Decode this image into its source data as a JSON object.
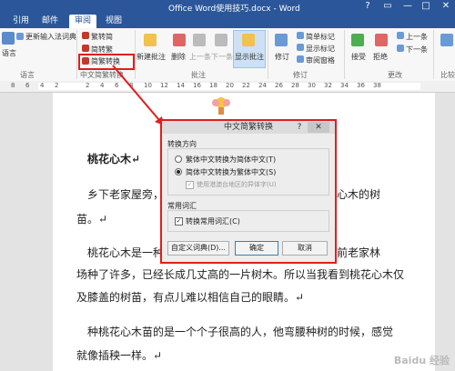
{
  "app": {
    "title": "Office Word使用技巧.docx - Word",
    "tabs": [
      "引用",
      "邮件",
      "审阅",
      "视图"
    ],
    "active_tab": "审阅",
    "window_buttons": [
      "?",
      "▭",
      "—",
      "□",
      "✕"
    ]
  },
  "ribbon": {
    "language": {
      "update_dict": "更新输入法词典",
      "label": "语言",
      "lang_btn": "语言"
    },
    "chinese": {
      "trad_to_simp": "繁转简",
      "simp_to_trad": "简转繁",
      "convert": "简繁转换",
      "label": "中文简繁转换"
    },
    "comments": {
      "new": "新建批注",
      "delete": "删除",
      "previous": "上一条",
      "next": "下一条",
      "show": "显示批注",
      "label": "批注"
    },
    "tracking": {
      "track": "修订",
      "simple_markup": "简单标记",
      "show_markup": "显示标记",
      "review_pane": "审阅窗格",
      "label": "修订"
    },
    "changes": {
      "accept": "接受",
      "reject": "拒绝",
      "prev": "上一条",
      "next": "下一条",
      "label": "更改"
    },
    "compare": {
      "label": "比较"
    }
  },
  "ruler": {
    "numbers": [
      "8",
      "6",
      "4",
      "2",
      "2",
      "4",
      "6",
      "8",
      "10",
      "12",
      "14",
      "16",
      "18",
      "20",
      "22",
      "24",
      "26",
      "28",
      "30",
      "32",
      "34",
      "36",
      "38"
    ]
  },
  "document": {
    "title": "桃花心木↵",
    "lines": [
      "乡下老家屋旁，",
      "心木的树",
      "苗。↵",
      "桃花心木是一种",
      "前老家林",
      "场种了许多，已经长成几丈高的一片树木。所以当我看到桃花心木仅",
      "及膝盖的树苗，有点儿难以相信自己的眼睛。↵",
      "种桃花心木苗的是一个个子很高的人，他弯腰种树的时候，感觉",
      "就像插秧一样。↵"
    ]
  },
  "dialog": {
    "title": "中文简繁转换",
    "help": "?",
    "close": "✕",
    "direction_label": "转换方向",
    "opt_trad_to_simp": "繁体中文转换为简体中文(T)",
    "opt_simp_to_trad": "简体中文转换为繁体中文(S)",
    "opt_hk_taiwan": "使用港澳台地区的异体字(U)",
    "common_label": "常用词汇",
    "opt_common": "转换常用词汇(C)",
    "custom_dict": "自定义词典(D)...",
    "ok": "确定",
    "cancel": "取消"
  },
  "watermark": "Baidu 经验"
}
